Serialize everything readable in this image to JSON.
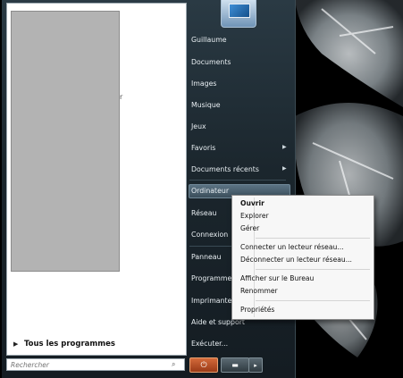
{
  "left_pane": {
    "all_programs": "Tous les programmes",
    "search_placeholder": "Rechercher"
  },
  "right_pane": {
    "items": [
      {
        "label": "Guillaume"
      },
      {
        "label": "Documents"
      },
      {
        "label": "Images"
      },
      {
        "label": "Musique"
      },
      {
        "label": "Jeux"
      },
      {
        "label": "Favoris"
      },
      {
        "label": "Documents récents"
      },
      {
        "label": "Ordinateur"
      },
      {
        "label": "Réseau"
      },
      {
        "label": "Connexion"
      },
      {
        "label": "Panneau"
      },
      {
        "label": "Programmes"
      },
      {
        "label": "Imprimantes"
      },
      {
        "label": "Aide et support"
      },
      {
        "label": "Exécuter..."
      }
    ]
  },
  "context_menu": {
    "items": [
      {
        "label": "Ouvrir",
        "bold": true
      },
      {
        "label": "Explorer"
      },
      {
        "label": "Gérer"
      },
      {
        "label": "Connecter un lecteur réseau..."
      },
      {
        "label": "Déconnecter un lecteur réseau..."
      },
      {
        "label": "Afficher sur le Bureau"
      },
      {
        "label": "Renommer"
      },
      {
        "label": "Propriétés"
      }
    ]
  },
  "colors": {
    "menu_bg": "#1b262d",
    "power": "#c0552a",
    "context_bg": "#f7f7f7"
  },
  "icons": [
    "chevron-right-icon",
    "search-icon",
    "power-icon",
    "lock-icon",
    "user-picture-icon"
  ]
}
